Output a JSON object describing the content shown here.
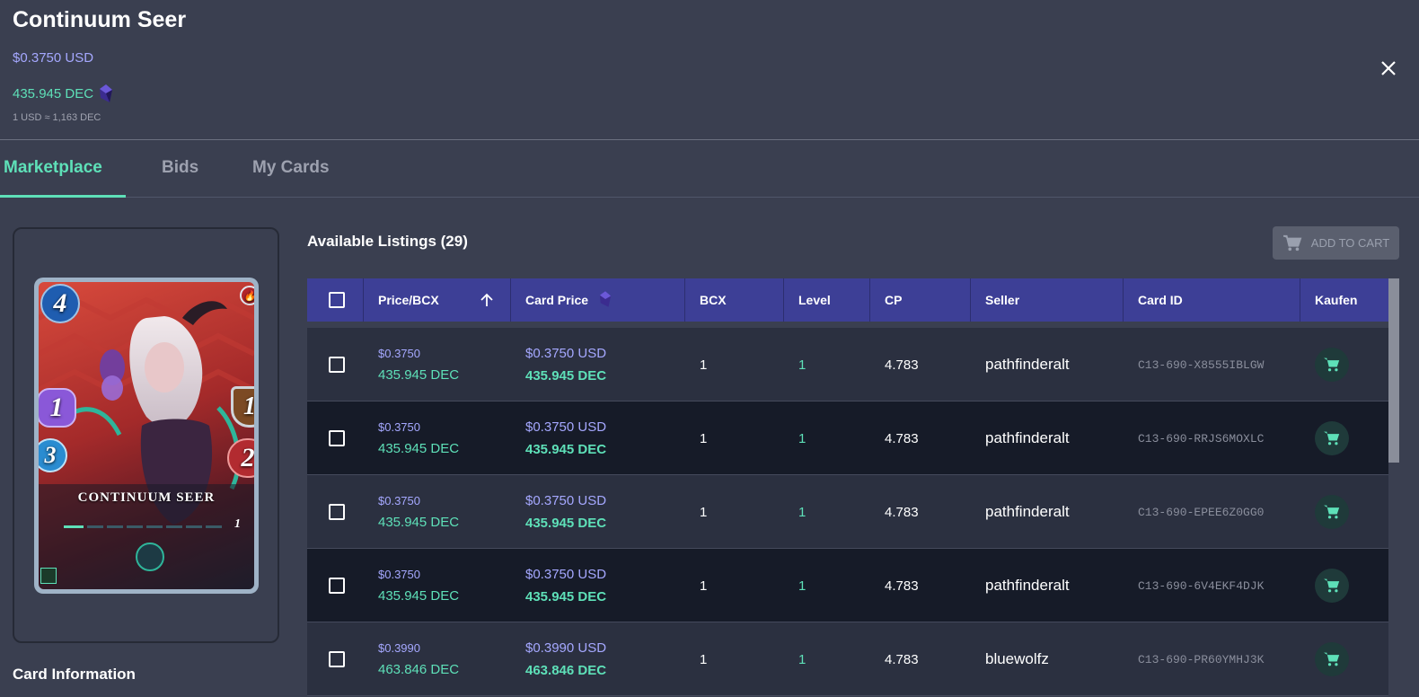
{
  "header": {
    "title": "Continuum Seer",
    "price_usd": "$0.3750 USD",
    "price_dec": "435.945 DEC",
    "rate": "1 USD ≈ 1,163 DEC"
  },
  "tabs": [
    {
      "label": "Marketplace",
      "active": true
    },
    {
      "label": "Bids",
      "active": false
    },
    {
      "label": "My Cards",
      "active": false
    }
  ],
  "card": {
    "name": "CONTINUUM SEER",
    "mana": "4",
    "magic": "1",
    "speed": "3",
    "armor": "1",
    "health": "2",
    "level": "1",
    "card_info_label": "Card Information"
  },
  "listings": {
    "title": "Available Listings (29)",
    "add_to_cart": "ADD TO CART",
    "columns": [
      "Price/BCX",
      "Card Price",
      "BCX",
      "Level",
      "CP",
      "Seller",
      "Card ID",
      "Kaufen"
    ],
    "rows": [
      {
        "price_bcx_usd": "$0.3750",
        "price_bcx_dec": "435.945 DEC",
        "card_usd": "$0.3750 USD",
        "card_dec": "435.945 DEC",
        "bcx": "1",
        "level": "1",
        "cp": "4.783",
        "seller": "pathfinderalt",
        "card_id": "C13-690-X8555IBLGW"
      },
      {
        "price_bcx_usd": "$0.3750",
        "price_bcx_dec": "435.945 DEC",
        "card_usd": "$0.3750 USD",
        "card_dec": "435.945 DEC",
        "bcx": "1",
        "level": "1",
        "cp": "4.783",
        "seller": "pathfinderalt",
        "card_id": "C13-690-RRJS6MOXLC"
      },
      {
        "price_bcx_usd": "$0.3750",
        "price_bcx_dec": "435.945 DEC",
        "card_usd": "$0.3750 USD",
        "card_dec": "435.945 DEC",
        "bcx": "1",
        "level": "1",
        "cp": "4.783",
        "seller": "pathfinderalt",
        "card_id": "C13-690-EPEE6Z0GG0"
      },
      {
        "price_bcx_usd": "$0.3750",
        "price_bcx_dec": "435.945 DEC",
        "card_usd": "$0.3750 USD",
        "card_dec": "435.945 DEC",
        "bcx": "1",
        "level": "1",
        "cp": "4.783",
        "seller": "pathfinderalt",
        "card_id": "C13-690-6V4EKF4DJK"
      },
      {
        "price_bcx_usd": "$0.3990",
        "price_bcx_dec": "463.846 DEC",
        "card_usd": "$0.3990 USD",
        "card_dec": "463.846 DEC",
        "bcx": "1",
        "level": "1",
        "cp": "4.783",
        "seller": "bluewolfz",
        "card_id": "C13-690-PR60YMHJ3K"
      }
    ]
  },
  "colors": {
    "background": "#3a3f50",
    "accent_green": "#5ee0b8",
    "usd_purple": "#a5a8ff",
    "table_header": "#3d3f96"
  },
  "icons": {
    "close": "close-icon",
    "dec_gem": "dec-gem-icon",
    "cart": "cart-icon",
    "sort": "sort-arrow-up-icon"
  }
}
